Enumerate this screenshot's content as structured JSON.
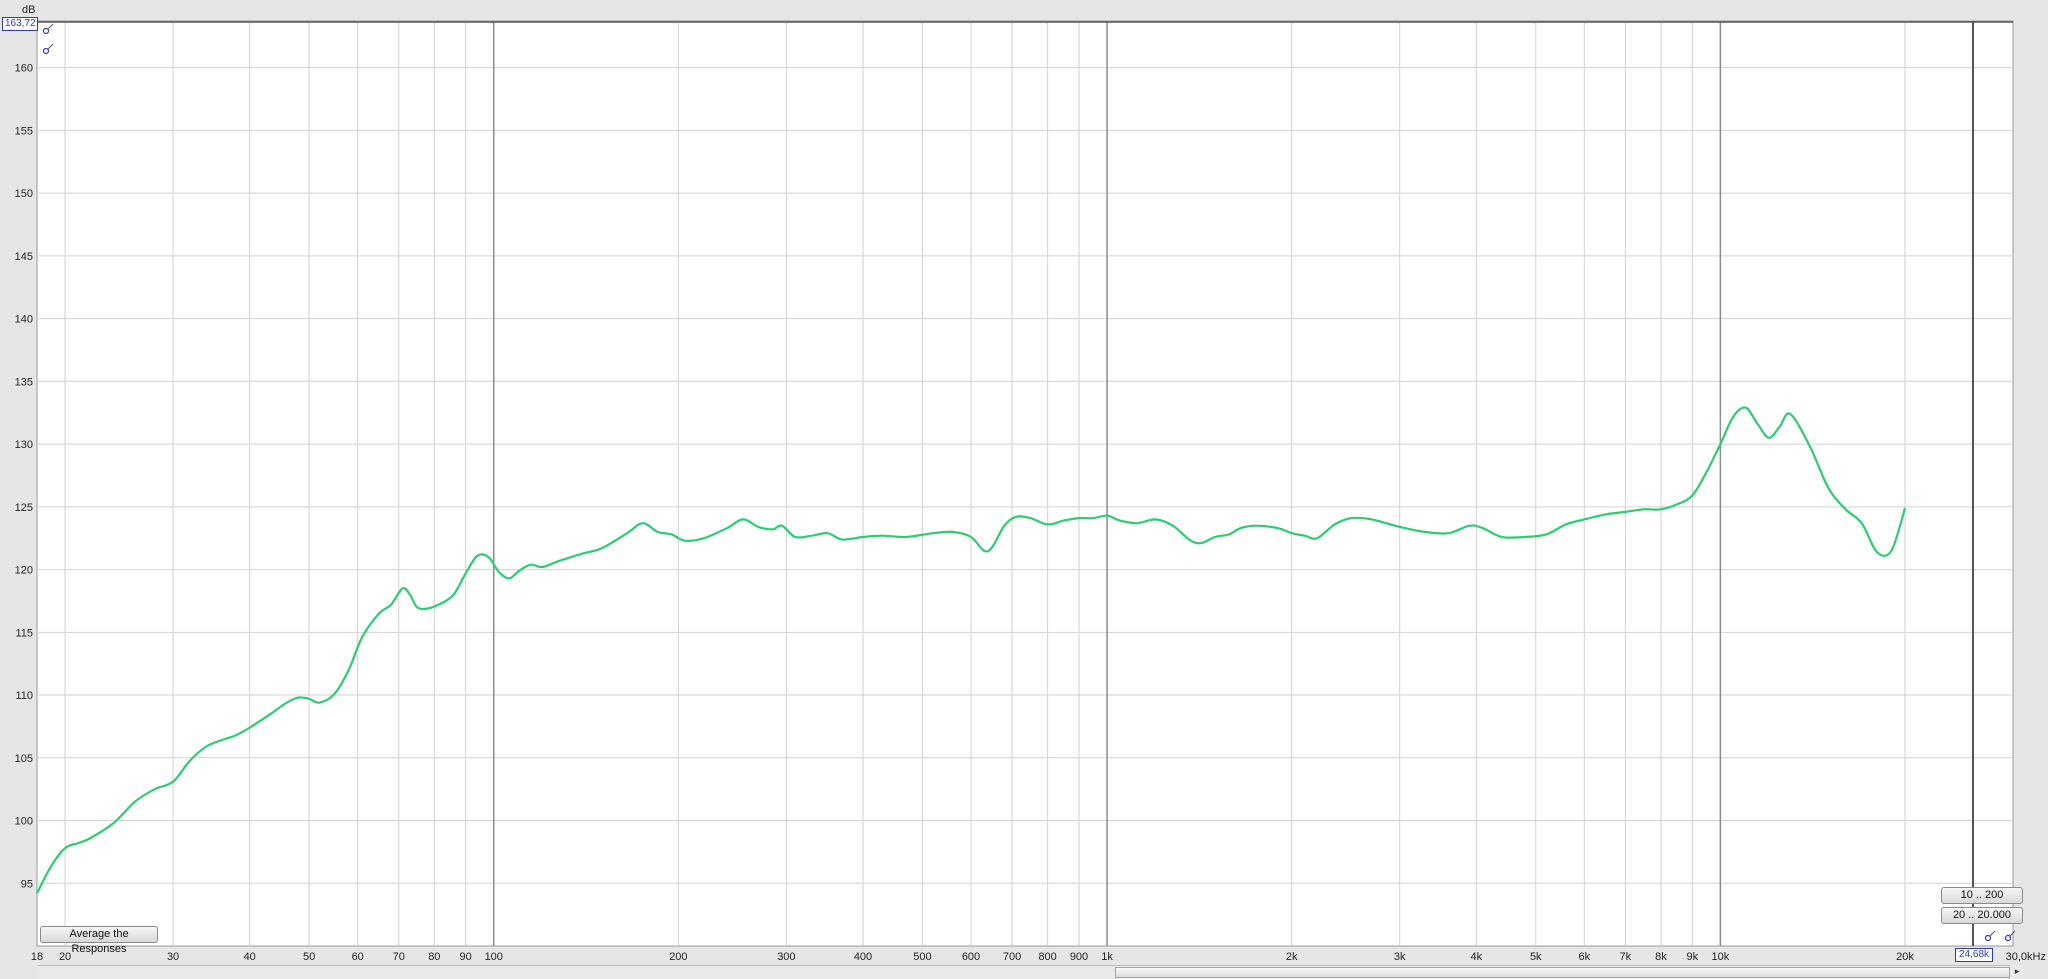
{
  "chart_data": {
    "type": "line",
    "xscale": "log",
    "xlim": [
      18,
      30000
    ],
    "ylim": [
      90,
      163.72
    ],
    "yunit": "dB",
    "xunit": "Hz",
    "y_ticks": [
      95,
      100,
      105,
      110,
      115,
      120,
      125,
      130,
      135,
      140,
      145,
      150,
      155,
      160
    ],
    "y_tick_labels": [
      "95",
      "100",
      "105",
      "110",
      "115",
      "120",
      "125",
      "130",
      "135",
      "140",
      "145",
      "150",
      "155",
      "160"
    ],
    "x_ticks": [
      18,
      20,
      30,
      40,
      50,
      60,
      70,
      80,
      90,
      100,
      200,
      300,
      400,
      500,
      600,
      700,
      800,
      900,
      1000,
      2000,
      3000,
      4000,
      5000,
      6000,
      7000,
      8000,
      9000,
      10000,
      20000,
      30000
    ],
    "x_tick_labels": [
      "18",
      "20",
      "30",
      "40",
      "50",
      "60",
      "70",
      "80",
      "90",
      "100",
      "200",
      "300",
      "400",
      "500",
      "600",
      "700",
      "800",
      "900",
      "1k",
      "2k",
      "3k",
      "4k",
      "5k",
      "6k",
      "7k",
      "8k",
      "9k",
      "10k",
      "20k",
      "30,0kHz"
    ],
    "grid": true,
    "series": [
      {
        "color": "#2ecc71",
        "x": [
          18,
          19,
          20,
          21,
          22,
          24,
          26,
          28,
          30,
          32,
          34,
          36,
          38,
          40,
          43,
          46,
          48,
          50,
          52,
          55,
          58,
          61,
          65,
          68,
          71,
          73,
          75,
          78,
          82,
          86,
          90,
          94,
          98,
          102,
          106,
          110,
          115,
          120,
          128,
          140,
          150,
          165,
          175,
          185,
          195,
          205,
          220,
          240,
          255,
          270,
          285,
          295,
          310,
          330,
          350,
          370,
          400,
          430,
          470,
          520,
          560,
          600,
          630,
          650,
          680,
          710,
          750,
          800,
          850,
          900,
          950,
          1000,
          1050,
          1120,
          1200,
          1280,
          1360,
          1420,
          1500,
          1580,
          1650,
          1750,
          1900,
          2000,
          2100,
          2200,
          2350,
          2500,
          2700,
          3000,
          3300,
          3600,
          3900,
          4100,
          4400,
          4800,
          5200,
          5600,
          6000,
          6500,
          7000,
          7500,
          8000,
          8500,
          9000,
          9500,
          10000,
          10500,
          11000,
          11500,
          12000,
          12500,
          13000,
          14000,
          15000,
          16000,
          17000,
          18000,
          19000,
          20000
        ],
        "y": [
          94.2,
          96.4,
          97.8,
          98.2,
          98.6,
          99.8,
          101.5,
          102.5,
          103.1,
          104.8,
          105.9,
          106.4,
          106.8,
          107.4,
          108.4,
          109.4,
          109.8,
          109.7,
          109.4,
          110.1,
          112.0,
          114.6,
          116.5,
          117.2,
          118.5,
          118.0,
          117.0,
          116.9,
          117.3,
          118.0,
          119.7,
          121.1,
          121.0,
          119.8,
          119.3,
          119.9,
          120.4,
          120.2,
          120.7,
          121.3,
          121.7,
          122.9,
          123.7,
          123.0,
          122.8,
          122.3,
          122.5,
          123.3,
          124.0,
          123.4,
          123.2,
          123.5,
          122.6,
          122.7,
          122.9,
          122.4,
          122.6,
          122.7,
          122.6,
          122.9,
          123.0,
          122.6,
          121.5,
          121.8,
          123.5,
          124.2,
          124.1,
          123.6,
          123.9,
          124.1,
          124.1,
          124.3,
          123.9,
          123.7,
          124.0,
          123.5,
          122.4,
          122.1,
          122.6,
          122.8,
          123.3,
          123.5,
          123.3,
          122.9,
          122.7,
          122.5,
          123.6,
          124.1,
          124.0,
          123.4,
          123.0,
          122.9,
          123.5,
          123.3,
          122.6,
          122.6,
          122.8,
          123.6,
          124.0,
          124.4,
          124.6,
          124.8,
          124.8,
          125.2,
          125.9,
          127.8,
          130.0,
          132.2,
          132.9,
          131.6,
          130.5,
          131.4,
          132.4,
          129.8,
          126.5,
          124.8,
          123.7,
          121.4,
          121.5,
          124.9
        ]
      }
    ]
  },
  "y_unit_label": "dB",
  "y_max_readout": "163,72",
  "x_max_readout": "24,68k",
  "buttons": {
    "average": "Average the Responses",
    "range_10_200": "10 .. 200",
    "range_20_20000": "20 .. 20.000"
  },
  "scroll": {
    "left_arrow": "◂",
    "right_arrow": "▸"
  }
}
